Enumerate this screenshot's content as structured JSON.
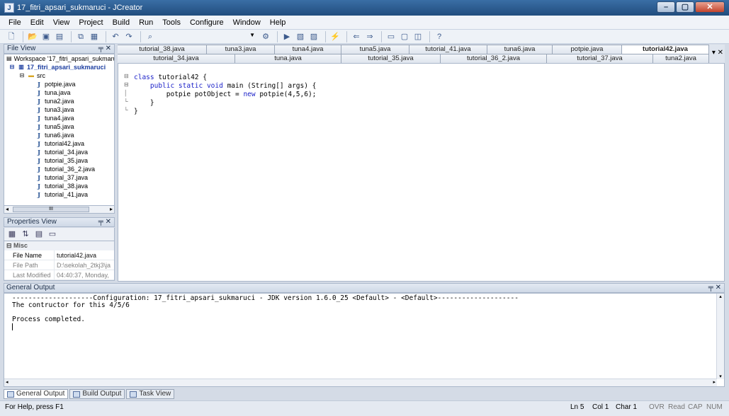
{
  "window": {
    "title": "17_fitri_apsari_sukmaruci - JCreator",
    "controls": [
      "–",
      "▢",
      "✕"
    ]
  },
  "menu": [
    "File",
    "Edit",
    "View",
    "Project",
    "Build",
    "Run",
    "Tools",
    "Configure",
    "Window",
    "Help"
  ],
  "file_view": {
    "header": "File View",
    "workspace": "Workspace '17_fitri_apsari_sukmaruci':",
    "project": "17_fitri_apsari_sukmaruci",
    "folder": "src",
    "files": [
      "potpie.java",
      "tuna.java",
      "tuna2.java",
      "tuna3.java",
      "tuna4.java",
      "tuna5.java",
      "tuna6.java",
      "tutorial42.java",
      "tutorial_34.java",
      "tutorial_35.java",
      "tutorial_36_2.java",
      "tutorial_37.java",
      "tutorial_38.java",
      "tutorial_41.java"
    ],
    "scroll_thumb": "III"
  },
  "properties": {
    "header": "Properties View",
    "category": "Misc",
    "rows": [
      {
        "key": "File Name",
        "value": "tutorial42.java",
        "dim": false
      },
      {
        "key": "File Path",
        "value": "D:\\sekolah_2tkj3\\ja",
        "dim": true
      },
      {
        "key": "Last Modified",
        "value": "04:40:37, Monday,",
        "dim": true
      }
    ]
  },
  "editor_tabs": {
    "row1": [
      "tutorial_38.java",
      "tuna3.java",
      "tuna4.java",
      "tuna5.java",
      "tutorial_41.java",
      "tuna6.java",
      "potpie.java",
      "tutorial42.java"
    ],
    "row2": [
      "tutorial_34.java",
      "tuna.java",
      "tutorial_35.java",
      "tutorial_36_2.java",
      "tutorial_37.java",
      "tuna2.java"
    ],
    "active": "tutorial42.java"
  },
  "code": {
    "line1_kw": "class",
    "line1": " tutorial42 {",
    "line2_indent": "    ",
    "line2_kw": "public static void",
    "line2": " main (String[] args) {",
    "line3_pre": "        potpie potObject = ",
    "line3_kw": "new",
    "line3": " potpie(4,5,6);",
    "line4": "    }",
    "line5": "}"
  },
  "output": {
    "header": "General Output",
    "line1": "--------------------Configuration: 17_fitri_apsari_sukmaruci - JDK version 1.6.0_25 <Default> - <Default>--------------------",
    "line2": "The contructor for this 4/5/6",
    "line3": "",
    "line4": "Process completed."
  },
  "bottom_tabs": [
    "General Output",
    "Build Output",
    "Task View"
  ],
  "status": {
    "help": "For Help, press F1",
    "ln": "Ln 5",
    "col": "Col 1",
    "char": "Char 1",
    "ovr": "OVR",
    "read": "Read",
    "cap": "CAP",
    "num": "NUM"
  }
}
